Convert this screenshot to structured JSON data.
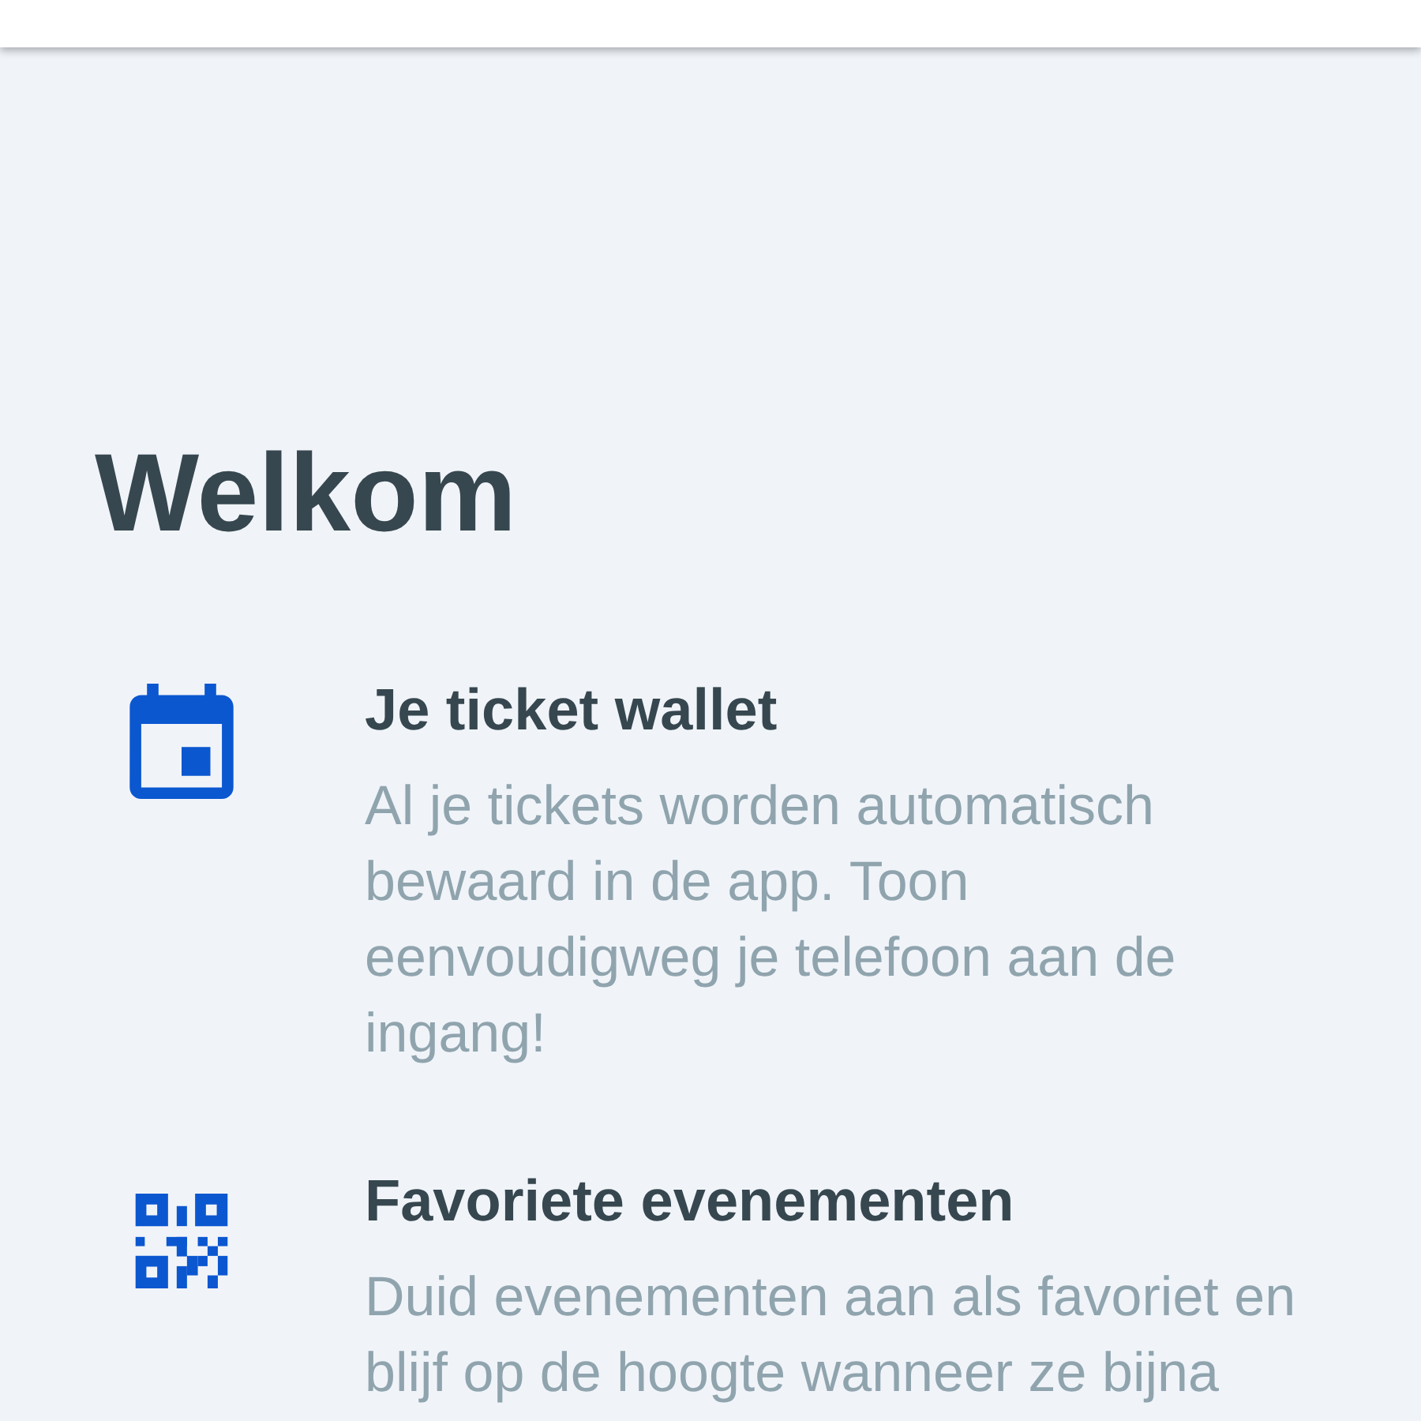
{
  "heading": "Welkom",
  "features": [
    {
      "kind": "calendar",
      "title": "Je ticket wallet",
      "description": "Al je tickets worden automatisch bewaard in de app. Toon eenvoudigweg je telefoon aan de ingang!"
    },
    {
      "kind": "qr",
      "title": "Favoriete evenementen",
      "description": "Duid evenementen aan als favoriet en blijf op de hoogte wanneer ze bijna"
    }
  ]
}
